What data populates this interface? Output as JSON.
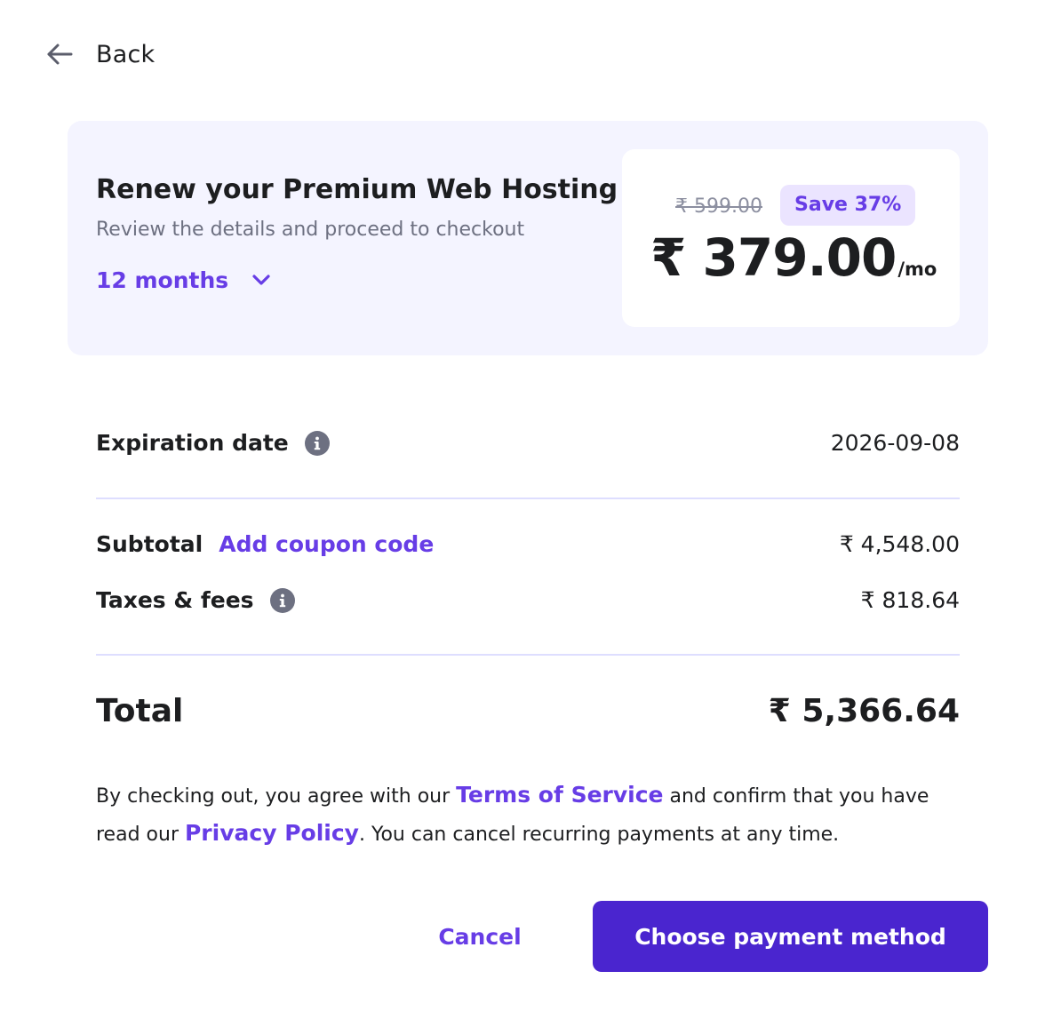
{
  "nav": {
    "back_label": "Back",
    "back_icon": "arrow-left-icon"
  },
  "summary": {
    "title": "Renew your Premium Web Hosting",
    "subtitle": "Review the details and proceed to checkout",
    "period": "12 months",
    "period_icon": "chevron-down-icon",
    "old_price": "₹ 599.00",
    "save_badge": "Save 37%",
    "price": "₹ 379.00",
    "price_unit": "/mo"
  },
  "details": {
    "expiration_label": "Expiration date",
    "expiration_value": "2026-09-08",
    "subtotal_label": "Subtotal",
    "coupon_link": "Add coupon code",
    "subtotal_value": "₹ 4,548.00",
    "taxes_label": "Taxes & fees",
    "taxes_value": "₹ 818.64",
    "total_label": "Total",
    "total_value": "₹ 5,366.64"
  },
  "legal": {
    "part1": "By checking out, you agree with our ",
    "terms_link": "Terms of Service",
    "part2": " and confirm that you have read our ",
    "privacy_link": "Privacy Policy",
    "part3": ". You can cancel recurring payments at any time."
  },
  "actions": {
    "cancel_label": "Cancel",
    "primary_label": "Choose payment method"
  },
  "colors": {
    "accent": "#673de6",
    "primary_button": "#4a25cf",
    "summary_background": "#f4f4ff",
    "badge_background": "#ebe4ff",
    "divider": "#dedeff",
    "info_icon": "#6d7081"
  }
}
